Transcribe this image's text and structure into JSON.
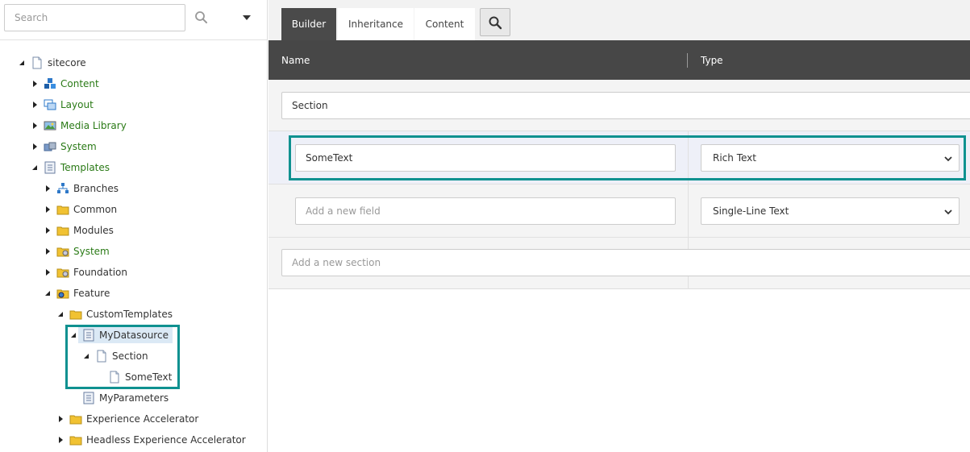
{
  "search": {
    "placeholder": "Search",
    "value": ""
  },
  "tree": {
    "items": [
      {
        "label": "sitecore",
        "expanded": true
      },
      {
        "label": "Content"
      },
      {
        "label": "Layout"
      },
      {
        "label": "Media Library"
      },
      {
        "label": "System"
      },
      {
        "label": "Templates",
        "expanded": true
      },
      {
        "label": "Branches"
      },
      {
        "label": "Common"
      },
      {
        "label": "Modules"
      },
      {
        "label": "System"
      },
      {
        "label": "Foundation"
      },
      {
        "label": "Feature",
        "expanded": true
      },
      {
        "label": "CustomTemplates",
        "expanded": true
      },
      {
        "label": "MyDatasource",
        "expanded": true,
        "selected": true
      },
      {
        "label": "Section",
        "expanded": true
      },
      {
        "label": "SomeText"
      },
      {
        "label": "MyParameters"
      },
      {
        "label": "Experience Accelerator"
      },
      {
        "label": "Headless Experience Accelerator"
      }
    ]
  },
  "tabs": [
    {
      "label": "Builder",
      "active": true
    },
    {
      "label": "Inheritance"
    },
    {
      "label": "Content"
    }
  ],
  "grid": {
    "header": {
      "name": "Name",
      "type": "Type"
    },
    "section_name": "Section",
    "fields": [
      {
        "name": "SomeText",
        "type": "Rich Text"
      }
    ],
    "new_field": {
      "placeholder": "Add a new field",
      "type": "Single-Line Text"
    },
    "new_section": {
      "placeholder": "Add a new section"
    }
  },
  "colors": {
    "highlight": "#0f9190",
    "header_bg": "#474747",
    "tab_active": "#4a4a4a",
    "tree_green": "#2a7a16"
  }
}
